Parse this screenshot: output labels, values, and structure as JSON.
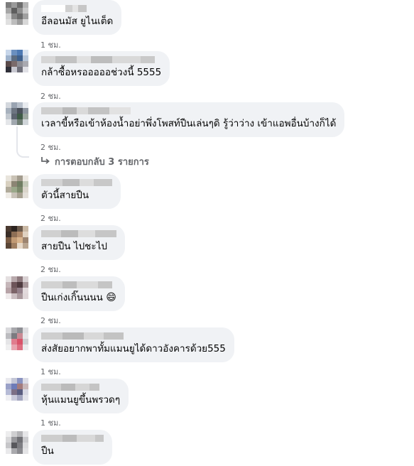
{
  "comments": [
    {
      "text": "อีลอนมัส ยูไนเต็ด",
      "time": "1 ชม."
    },
    {
      "text": "กล้าซื้อหรอออออช่วงนี้ 5555",
      "time": "2 ชม."
    },
    {
      "text": "เวลาขี้หรือเข้าห้องน้ำอย่าพึ่งโพสท์ปืนเล่นๆดิ รู้ว่าว่าง เข้าแอพอื่นบ้างก็ได้",
      "time": "2 ชม.",
      "replies": "การตอบกลับ 3 รายการ"
    },
    {
      "text": "ตัวนี้สายปืน",
      "time": "2 ชม."
    },
    {
      "text": "สายปืน ไปชะไป",
      "time": "2 ชม."
    },
    {
      "text": "ปืนเก่งเกิ๊นนนน",
      "emoji": "😄",
      "time": "2 ชม."
    },
    {
      "text": "ส่งสัยอยากพาทั้มแมนยูได้ดาวอังคารด้วย555",
      "time": "1 ชม."
    },
    {
      "text": "หุ้นแมนยูขึ้นพรวดๆ",
      "time": "1 ชม."
    },
    {
      "text": "ปืน",
      "time": ""
    }
  ],
  "colors": {
    "bubble": "#f0f2f5",
    "meta": "#65676b",
    "text": "#050505"
  },
  "icons": {
    "reply_arrow": "reply-arrow-icon"
  }
}
